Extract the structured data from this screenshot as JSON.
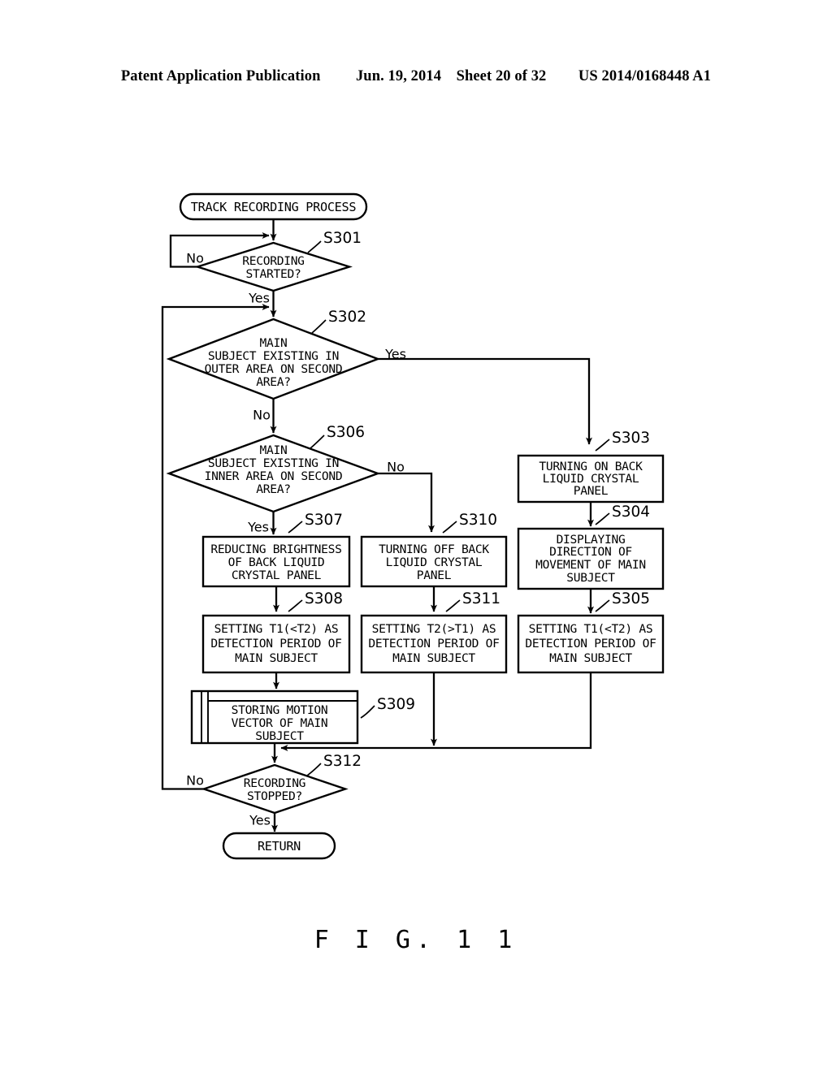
{
  "header": {
    "publication": "Patent Application Publication",
    "date": "Jun. 19, 2014",
    "sheet": "Sheet 20 of 32",
    "number": "US 2014/0168448 A1"
  },
  "figure": {
    "caption": "F I G.  1 1"
  },
  "flowchart": {
    "title": "TRACK RECORDING PROCESS",
    "nodes": {
      "start": {
        "id": "start",
        "type": "terminator",
        "text": "TRACK RECORDING PROCESS"
      },
      "s301": {
        "id": "S301",
        "type": "decision",
        "line1": "RECORDING",
        "line2": "STARTED?"
      },
      "s302": {
        "id": "S302",
        "type": "decision",
        "line1": "MAIN",
        "line2": "SUBJECT EXISTING IN",
        "line3": "OUTER AREA ON SECOND",
        "line4": "AREA?"
      },
      "s306": {
        "id": "S306",
        "type": "decision",
        "line1": "MAIN",
        "line2": "SUBJECT EXISTING IN",
        "line3": "INNER AREA ON SECOND",
        "line4": "AREA?"
      },
      "s303": {
        "id": "S303",
        "type": "process",
        "line1": "TURNING ON BACK",
        "line2": "LIQUID CRYSTAL",
        "line3": "PANEL"
      },
      "s304": {
        "id": "S304",
        "type": "process",
        "line1": "DISPLAYING",
        "line2": "DIRECTION OF",
        "line3": "MOVEMENT OF MAIN",
        "line4": "SUBJECT"
      },
      "s305": {
        "id": "S305",
        "type": "process",
        "line1": "SETTING T1(<T2) AS",
        "line2": "DETECTION PERIOD OF",
        "line3": "MAIN SUBJECT"
      },
      "s307": {
        "id": "S307",
        "type": "process",
        "line1": "REDUCING BRIGHTNESS",
        "line2": "OF BACK LIQUID",
        "line3": "CRYSTAL PANEL"
      },
      "s308": {
        "id": "S308",
        "type": "process",
        "line1": "SETTING T1(<T2) AS",
        "line2": "DETECTION PERIOD OF",
        "line3": "MAIN SUBJECT"
      },
      "s310": {
        "id": "S310",
        "type": "process",
        "line1": "TURNING OFF BACK",
        "line2": "LIQUID CRYSTAL",
        "line3": "PANEL"
      },
      "s311": {
        "id": "S311",
        "type": "process",
        "line1": "SETTING T2(>T1) AS",
        "line2": "DETECTION PERIOD OF",
        "line3": "MAIN SUBJECT"
      },
      "s309": {
        "id": "S309",
        "type": "predefined-process",
        "line1": "STORING MOTION",
        "line2": "VECTOR OF MAIN",
        "line3": "SUBJECT"
      },
      "s312": {
        "id": "S312",
        "type": "decision",
        "line1": "RECORDING",
        "line2": "STOPPED?"
      },
      "end": {
        "id": "end",
        "type": "terminator",
        "text": "RETURN"
      }
    },
    "branch_labels": {
      "s301_no": "No",
      "s301_yes": "Yes",
      "s302_yes": "Yes",
      "s302_no": "No",
      "s306_no": "No",
      "s306_yes": "Yes",
      "s312_no": "No",
      "s312_yes": "Yes"
    },
    "colors": {
      "stroke": "#000000",
      "fill": "#ffffff",
      "page_background": "#ffffff"
    }
  }
}
